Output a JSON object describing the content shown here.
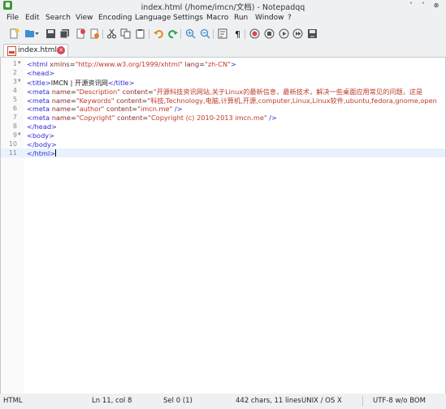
{
  "window": {
    "title": "index.html (/home/imcn/文档) - Notepadqq",
    "minimize": "˅",
    "maximize": "˄",
    "close": "⊗"
  },
  "menu": [
    "File",
    "Edit",
    "Search",
    "View",
    "Encoding",
    "Language",
    "Settings",
    "Macro",
    "Run",
    "Window",
    "?"
  ],
  "toolbar_icons": [
    "new-file-icon",
    "open-file-icon",
    "open-dropdown-icon",
    "save-icon",
    "save-all-icon",
    "close-file-icon",
    "close-all-icon",
    "cut-icon",
    "copy-icon",
    "paste-icon",
    "undo-icon",
    "redo-icon",
    "zoom-in-icon",
    "zoom-out-icon",
    "word-wrap-icon",
    "show-all-chars-icon",
    "macro-record-icon",
    "macro-stop-icon",
    "macro-play-icon",
    "macro-run-multiple-icon",
    "macro-save-icon"
  ],
  "tab": {
    "label": "index.html",
    "close": "✕"
  },
  "editor": {
    "lines": [
      {
        "n": "1",
        "fold": "▼"
      },
      {
        "n": "2",
        "fold": ""
      },
      {
        "n": "3",
        "fold": "▼"
      },
      {
        "n": "4",
        "fold": ""
      },
      {
        "n": "5",
        "fold": ""
      },
      {
        "n": "6",
        "fold": ""
      },
      {
        "n": "7",
        "fold": ""
      },
      {
        "n": "8",
        "fold": ""
      },
      {
        "n": "9",
        "fold": "▼"
      },
      {
        "n": "10",
        "fold": ""
      },
      {
        "n": "11",
        "fold": ""
      }
    ],
    "code": {
      "l1_open": "<html ",
      "l1_a1": "xmlns",
      "l1_eq1": "=",
      "l1_v1": "\"http://www.w3.org/1999/xhtml\"",
      "l1_sp": " ",
      "l1_a2": "lang",
      "l1_eq2": "=",
      "l1_v2": "\"zh-CN\"",
      "l1_close": ">",
      "l2": "<head>",
      "l3_open": "<title>",
      "l3_text": "IMCN | 开源资讯网",
      "l3_close": "</title>",
      "l4_open": "<meta ",
      "l4_a1": "name",
      "l4_eq1": "=",
      "l4_v1": "\"Description\"",
      "l4_sp": " ",
      "l4_a2": "content",
      "l4_eq2": "=",
      "l4_v2": "\"开源科技资讯网站,关于Linux的最新信息，最新技术，解决一些桌面应用常见的问题，这是",
      "l5_open": "<meta ",
      "l5_a1": "name",
      "l5_eq1": "=",
      "l5_v1": "\"Keywords\"",
      "l5_sp": " ",
      "l5_a2": "content",
      "l5_eq2": "=",
      "l5_v2": "\"科技,Technology,电脑,计算机,开源,computer,Linux,Linux软件,ubuntu,fedora,gnome,open",
      "l6_open": "<meta ",
      "l6_a1": "name",
      "l6_eq1": "=",
      "l6_v1": "\"author\"",
      "l6_sp": " ",
      "l6_a2": "content",
      "l6_eq2": "=",
      "l6_v2": "\"imcn.me\"",
      "l6_close": " />",
      "l7_open": "<meta ",
      "l7_a1": "name",
      "l7_eq1": "=",
      "l7_v1": "\"Copyright\"",
      "l7_sp": " ",
      "l7_a2": "content",
      "l7_eq2": "=",
      "l7_v2": "\"Copyright (c) 2010-2013 imcn.me\"",
      "l7_close": " />",
      "l8": "</head>",
      "l9": "<body>",
      "l10": "</body>",
      "l11": "</html>"
    }
  },
  "status": {
    "language": "HTML",
    "position": "Ln 11, col 8",
    "selection": "Sel 0 (1)",
    "stats": "442 chars, 11 lines",
    "eol": "UNIX / OS X",
    "encoding": "UTF-8 w/o BOM"
  },
  "colors": {
    "tag": "#2b2bd6",
    "attribute": "#8b2a2a",
    "string": "#c0392b",
    "current_line": "#e8f2fe",
    "tab_close": "#da4453"
  }
}
